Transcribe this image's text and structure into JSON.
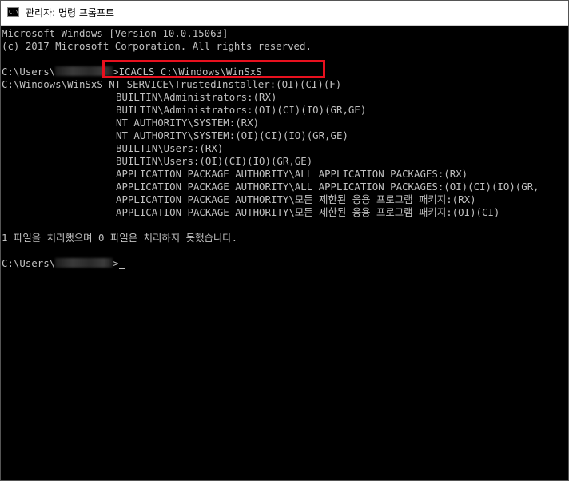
{
  "window": {
    "title": "관리자: 명령 프롬프트",
    "icon": "cmd-icon",
    "icon_glyph": "C:\\"
  },
  "console": {
    "version_line": "Microsoft Windows [Version 10.0.15063]",
    "copyright_line": "(c) 2017 Microsoft Corporation. All rights reserved.",
    "prompt_prefix": "C:\\Users\\",
    "command_text": ">ICACLS C:\\Windows\\WinSxS",
    "result_path": "C:\\Windows\\WinSxS",
    "result_first_perm": " NT SERVICE\\TrustedInstaller:(OI)(CI)(F)",
    "permissions": [
      "BUILTIN\\Administrators:(RX)",
      "BUILTIN\\Administrators:(OI)(CI)(IO)(GR,GE)",
      "NT AUTHORITY\\SYSTEM:(RX)",
      "NT AUTHORITY\\SYSTEM:(OI)(CI)(IO)(GR,GE)",
      "BUILTIN\\Users:(RX)",
      "BUILTIN\\Users:(OI)(CI)(IO)(GR,GE)",
      "APPLICATION PACKAGE AUTHORITY\\ALL APPLICATION PACKAGES:(RX)",
      "APPLICATION PACKAGE AUTHORITY\\ALL APPLICATION PACKAGES:(OI)(CI)(IO)(GR,",
      "APPLICATION PACKAGE AUTHORITY\\모든 제한된 응용 프로그램 패키지:(RX)",
      "APPLICATION PACKAGE AUTHORITY\\모든 제한된 응용 프로그램 패키지:(OI)(CI)"
    ],
    "summary_line": "1 파일을 처리했으며 0 파일은 처리하지 못했습니다.",
    "final_prompt_suffix": ">"
  },
  "colors": {
    "console_bg": "#000000",
    "console_text": "#c0c0c0",
    "highlight_border": "#e8101e",
    "titlebar_bg": "#ffffff"
  }
}
